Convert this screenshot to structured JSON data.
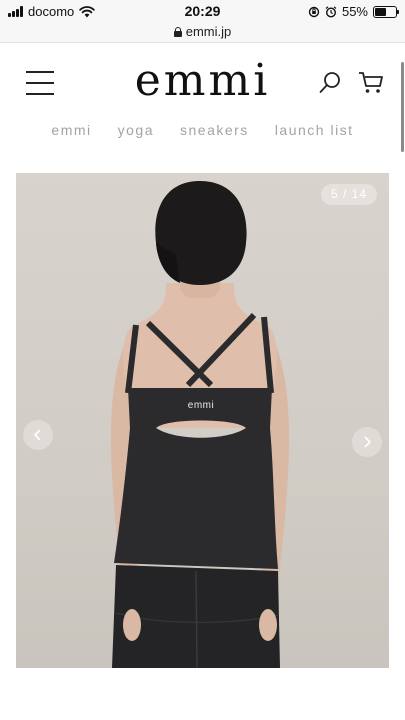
{
  "status_bar": {
    "carrier": "docomo",
    "time": "20:29",
    "battery_percent": "55%",
    "battery_level": 0.55
  },
  "browser": {
    "url": "emmi.jp"
  },
  "header": {
    "logo": "emmi",
    "icons": [
      "hamburger-menu-icon",
      "search-icon",
      "cart-icon"
    ]
  },
  "nav": {
    "items": [
      {
        "label": "emmi"
      },
      {
        "label": "yoga"
      },
      {
        "label": "sneakers"
      },
      {
        "label": "launch list"
      }
    ]
  },
  "gallery": {
    "counter": "5 / 14",
    "current": 5,
    "total": 14,
    "garment_print": "emmi"
  },
  "colors": {
    "nav_text": "#a3a3a3",
    "photo_background": "#d3cec7",
    "garment": "#2b2a2c"
  }
}
